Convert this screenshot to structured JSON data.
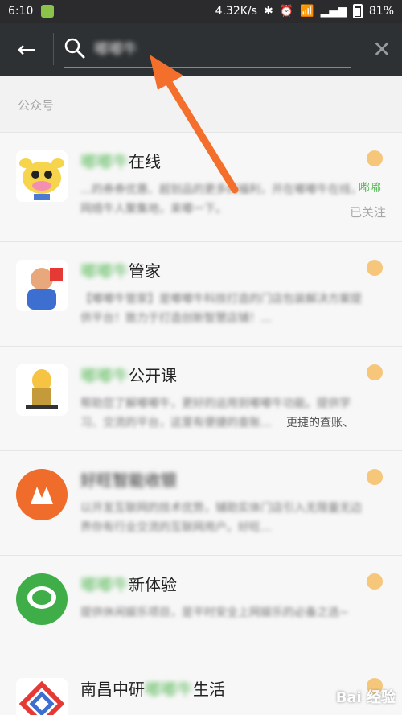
{
  "status_bar": {
    "time": "6:10",
    "speed": "4.32K/s",
    "battery": "81%"
  },
  "search": {
    "value": "嘟嘟牛"
  },
  "section": {
    "title": "公众号"
  },
  "accounts": [
    {
      "name_hl": "嘟嘟牛",
      "name_suffix": "在线",
      "desc": "…的券券优惠、超划品的更多的福利，开在嘟嘟牛在线，网络牛人聚集地，来嘟一下。",
      "followed": "已关注",
      "side_text": "嘟嘟"
    },
    {
      "name_hl": "嘟嘟牛",
      "name_suffix": "管家",
      "desc": "【嘟嘟牛管家】是嘟嘟牛科技打造的门店包装解决方案提供平台！致力于打造创新智慧店铺！…"
    },
    {
      "name_hl": "嘟嘟牛",
      "name_suffix": "公开课",
      "desc": "帮助您了解嘟嘟牛，更好的运用到嘟嘟牛功能。提供学习、交流的平台，这里有便捷的查账…",
      "side_text": "更捷的查账、"
    },
    {
      "name_hl": "好旺智能收银",
      "name_suffix": "",
      "desc": "以开发互联网的技术优势，辅助实体门店引入无限量无边界你有行业交流的互联网用户。好旺…"
    },
    {
      "name_hl": "嘟嘟牛",
      "name_suffix": "新体验",
      "desc": "提供休闲娱乐项目，是平时安全上网娱乐的必备之选~"
    },
    {
      "name_prefix": "南昌中研",
      "name_hl": "嘟嘟牛",
      "name_suffix": "生活"
    }
  ],
  "watermark": "Bai 经验"
}
